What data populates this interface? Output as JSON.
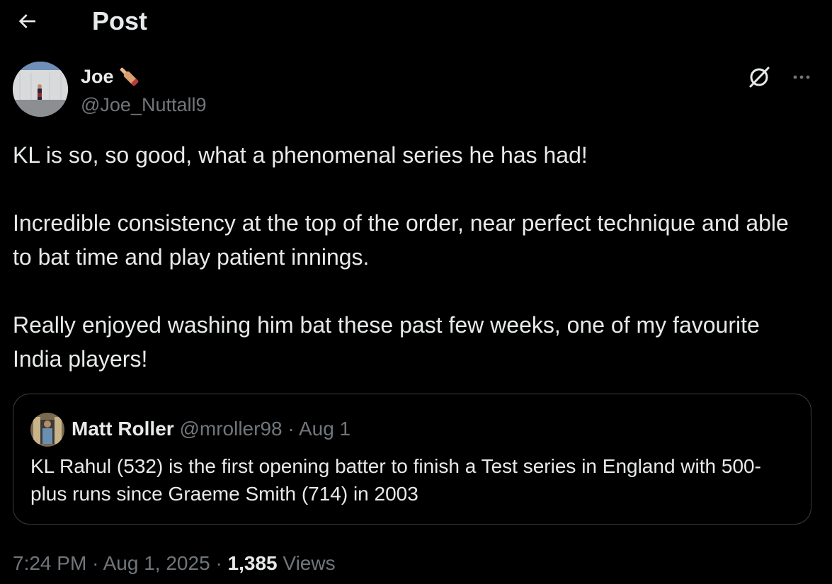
{
  "header": {
    "back_icon": "arrow-left-icon",
    "title": "Post"
  },
  "post": {
    "author": {
      "name": "Joe",
      "name_emoji_icon": "cricket-bat-icon",
      "handle": "@Joe_Nuttall9",
      "avatar_icon": "avatar-photo"
    },
    "actions": {
      "grok_icon": "grok-icon",
      "more_icon": "more-horizontal-icon"
    },
    "paragraphs": [
      "KL is so, so good, what a phenomenal series he has had!",
      "Incredible consistency at the top of the order, near perfect technique and able to bat time and play patient innings.",
      "Really enjoyed washing him bat these past few weeks, one of my favourite India players!"
    ],
    "quote": {
      "name": "Matt Roller",
      "handle": "@mroller98",
      "separator": "·",
      "date": "Aug 1",
      "text": "KL Rahul (532) is the first opening batter to finish a Test series in England with 500-plus runs since Graeme Smith (714) in 2003"
    },
    "meta": {
      "time": "7:24 PM",
      "separator": "·",
      "date": "Aug 1, 2025",
      "views_count": "1,385",
      "views_label": "Views"
    }
  },
  "colors": {
    "background": "#000000",
    "text_primary": "#e7e9ea",
    "text_secondary": "#71767b",
    "border": "#3a3f44"
  }
}
